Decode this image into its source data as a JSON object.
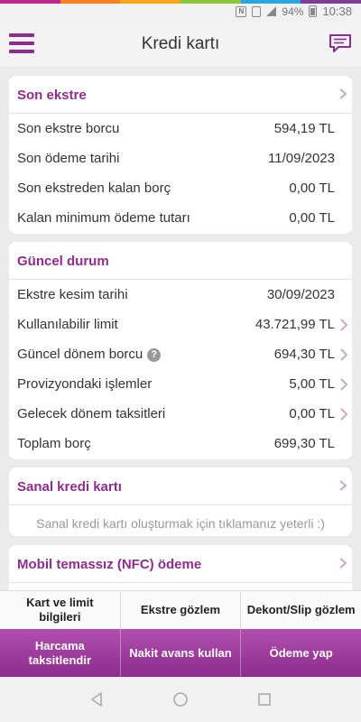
{
  "status_bar": {
    "battery": "94%",
    "time": "10:38",
    "accent_colors": [
      "#c2268e",
      "#f58220",
      "#f8a51c",
      "#8cc63f",
      "#28a7e0",
      "#7c3f98"
    ]
  },
  "header": {
    "title": "Kredi kartı",
    "menu_icon": "hamburger-icon",
    "chat_icon": "chat-icon"
  },
  "last_statement": {
    "title": "Son ekstre",
    "rows": [
      {
        "label": "Son ekstre borcu",
        "value": "594,19 TL"
      },
      {
        "label": "Son ödeme tarihi",
        "value": "11/09/2023"
      },
      {
        "label": "Son ekstreden kalan borç",
        "value": "0,00 TL"
      },
      {
        "label": "Kalan minimum ödeme tutarı",
        "value": "0,00 TL"
      }
    ]
  },
  "current_status": {
    "title": "Güncel durum",
    "rows": [
      {
        "label": "Ekstre kesim tarihi",
        "value": "30/09/2023"
      },
      {
        "label": "Kullanılabilir limit",
        "value": "43.721,99 TL"
      },
      {
        "label": "Güncel dönem borcu",
        "value": "694,30 TL"
      },
      {
        "label": "Provizyondaki işlemler",
        "value": "5,00 TL"
      },
      {
        "label": "Gelecek dönem taksitleri",
        "value": "0,00 TL"
      },
      {
        "label": "Toplam borç",
        "value": "699,30 TL"
      }
    ]
  },
  "virtual_card": {
    "title": "Sanal kredi kartı",
    "hint": "Sanal kredi kartı oluşturmak için tıklamanız yeterli :)"
  },
  "nfc": {
    "title": "Mobil temassız (NFC) ödeme"
  },
  "actions": {
    "row1": [
      "Kart ve limit bilgileri",
      "Ekstre gözlem",
      "Dekont/Slip gözlem"
    ],
    "row2": [
      "Harcama taksitlendir",
      "Nakit avans kullan",
      "Ödeme yap"
    ]
  },
  "colors": {
    "brand": "#8e2c8f",
    "chevron": "#c9a6cc"
  }
}
